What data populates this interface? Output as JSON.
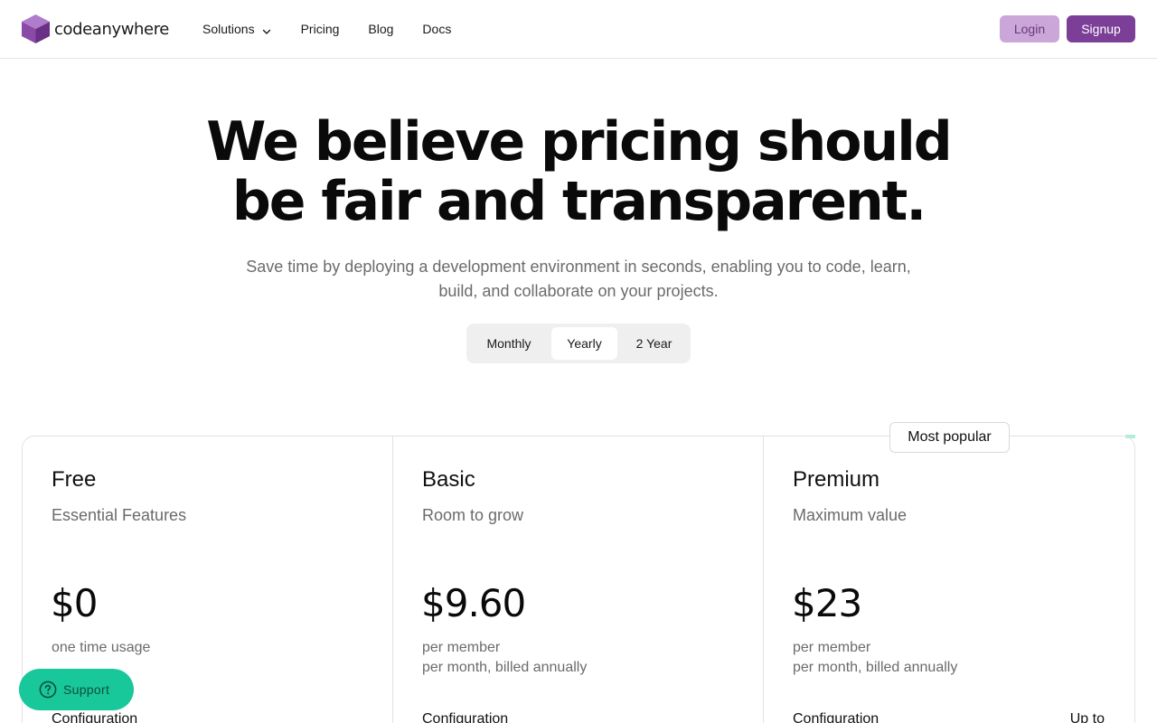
{
  "brand": {
    "name": "codeanywhere",
    "accent": "#7c3f98",
    "logo_light": "#b07ccc",
    "logo_dark": "#6a2f86"
  },
  "nav": {
    "items": [
      {
        "label": "Solutions",
        "has_dropdown": true
      },
      {
        "label": "Pricing"
      },
      {
        "label": "Blog"
      },
      {
        "label": "Docs"
      }
    ]
  },
  "auth": {
    "login_label": "Login",
    "signup_label": "Signup"
  },
  "hero": {
    "title_line1": "We believe pricing should",
    "title_line2": "be fair and transparent.",
    "subtitle": "Save time by deploying a development environment in seconds, enabling you to code, learn, build, and collaborate on your projects."
  },
  "billing": {
    "options": [
      "Monthly",
      "Yearly",
      "2 Year"
    ],
    "selected": "Yearly"
  },
  "badge": {
    "most_popular": "Most popular"
  },
  "plans": [
    {
      "name": "Free",
      "tagline": "Essential Features",
      "price": "$0",
      "unit_line1": "one time usage",
      "unit_line2": "",
      "feature_label": "Configuration",
      "feature_value": ""
    },
    {
      "name": "Basic",
      "tagline": "Room to grow",
      "price": "$9.60",
      "unit_line1": "per member",
      "unit_line2": "per month, billed annually",
      "feature_label": "Configuration",
      "feature_value": ""
    },
    {
      "name": "Premium",
      "tagline": "Maximum value",
      "price": "$23",
      "unit_line1": "per member",
      "unit_line2": "per month, billed annually",
      "feature_label": "Configuration",
      "feature_value": "Up to"
    }
  ],
  "support": {
    "label": "Support",
    "color": "#18c89a"
  },
  "icons": {
    "logo": "cube-logo-icon",
    "dropdown": "chevron-down-icon",
    "support": "question-circle-icon"
  }
}
